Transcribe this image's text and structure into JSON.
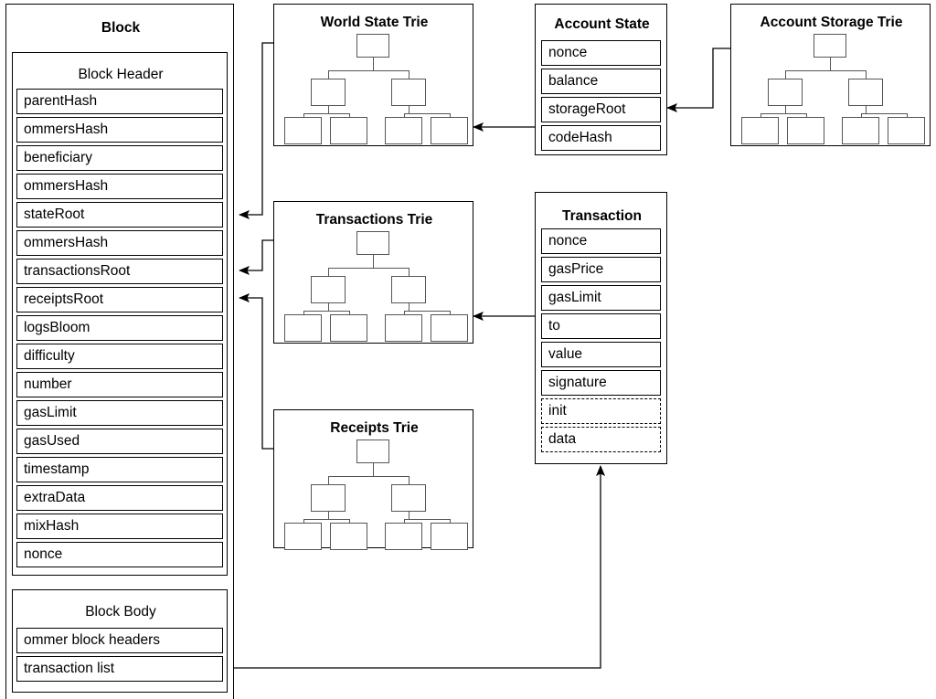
{
  "diagram": {
    "title_block": "Block",
    "panels": {
      "block": {
        "label": "Block"
      },
      "block_header": {
        "label": "Block Header"
      },
      "block_body": {
        "label": "Block Body"
      },
      "world_state_trie": {
        "label": "World State Trie"
      },
      "transactions_trie": {
        "label": "Transactions Trie"
      },
      "receipts_trie": {
        "label": "Receipts Trie"
      },
      "account_state": {
        "label": "Account State"
      },
      "account_storage_trie": {
        "label": "Account Storage Trie"
      },
      "transaction": {
        "label": "Transaction"
      }
    },
    "block_header_fields": [
      "parentHash",
      "ommersHash",
      "beneficiary",
      "ommersHash",
      "stateRoot",
      "ommersHash",
      "transactionsRoot",
      "receiptsRoot",
      "logsBloom",
      "difficulty",
      "number",
      "gasLimit",
      "gasUsed",
      "timestamp",
      "extraData",
      "mixHash",
      "nonce"
    ],
    "block_body_fields": [
      "ommer block headers",
      "transaction list"
    ],
    "account_state_fields": [
      "nonce",
      "balance",
      "storageRoot",
      "codeHash"
    ],
    "transaction_fields": [
      {
        "label": "nonce",
        "style": "solid"
      },
      {
        "label": "gasPrice",
        "style": "solid"
      },
      {
        "label": "gasLimit",
        "style": "solid"
      },
      {
        "label": "to",
        "style": "solid"
      },
      {
        "label": "value",
        "style": "solid"
      },
      {
        "label": "signature",
        "style": "solid"
      },
      {
        "label": "init",
        "style": "dashed"
      },
      {
        "label": "data",
        "style": "dashed"
      }
    ],
    "colors": {
      "stroke": "#000000",
      "trie_stroke": "#555555",
      "background": "#ffffff"
    }
  }
}
